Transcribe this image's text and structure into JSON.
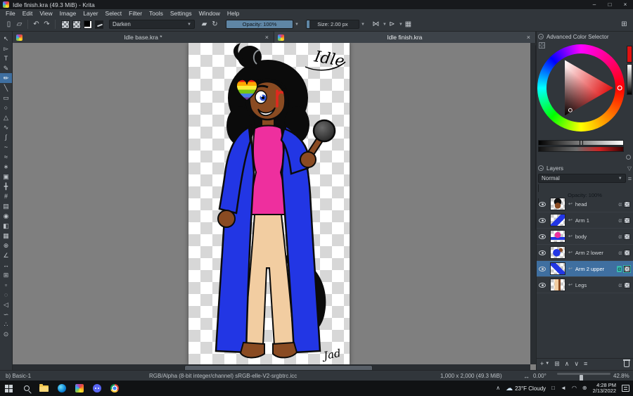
{
  "window": {
    "title": "Idle finish.kra (49.3 MiB) - Krita"
  },
  "menubar": {
    "items": [
      "File",
      "Edit",
      "View",
      "Image",
      "Layer",
      "Select",
      "Filter",
      "Tools",
      "Settings",
      "Window",
      "Help"
    ]
  },
  "toolbar": {
    "blend_mode": "Darken",
    "opacity": "Opacity: 100%",
    "size": "Size: 2.00 px"
  },
  "toolbox": {
    "tools": [
      {
        "name": "select-shapes",
        "glyph": "↖"
      },
      {
        "name": "edit-shapes",
        "glyph": "▻"
      },
      {
        "name": "text",
        "glyph": "T"
      },
      {
        "name": "calligraphy",
        "glyph": "✎"
      },
      {
        "name": "freehand-brush",
        "glyph": "✏",
        "active": true
      },
      {
        "name": "line",
        "glyph": "╲"
      },
      {
        "name": "rectangle",
        "glyph": "▭"
      },
      {
        "name": "ellipse",
        "glyph": "○"
      },
      {
        "name": "polygon",
        "glyph": "△"
      },
      {
        "name": "polyline",
        "glyph": "∿"
      },
      {
        "name": "bezier-curve",
        "glyph": "∫"
      },
      {
        "name": "freehand-path",
        "glyph": "~"
      },
      {
        "name": "dynamic-brush",
        "glyph": "≈"
      },
      {
        "name": "multibrush",
        "glyph": "∗"
      },
      {
        "name": "transform",
        "glyph": "▣"
      },
      {
        "name": "move",
        "glyph": "╋"
      },
      {
        "name": "crop",
        "glyph": "#"
      },
      {
        "name": "gradient",
        "glyph": "▤"
      },
      {
        "name": "color-sampler",
        "glyph": "◉"
      },
      {
        "name": "fill",
        "glyph": "◧"
      },
      {
        "name": "pattern-fill",
        "glyph": "▦"
      },
      {
        "name": "smart-patch",
        "glyph": "⊕"
      },
      {
        "name": "assistants",
        "glyph": "∠"
      },
      {
        "name": "measure",
        "glyph": "↔"
      },
      {
        "name": "reference-images",
        "glyph": "⊞"
      },
      {
        "name": "rect-select",
        "glyph": "▫"
      },
      {
        "name": "ellipse-select",
        "glyph": "◌"
      },
      {
        "name": "polygon-select",
        "glyph": "◁"
      },
      {
        "name": "freehand-select",
        "glyph": "∽"
      },
      {
        "name": "contiguous-select",
        "glyph": "∴"
      },
      {
        "name": "zoom",
        "glyph": "⊙"
      }
    ]
  },
  "tabs": [
    {
      "label": "Idle base.kra *"
    },
    {
      "label": "Idle finish.kra"
    }
  ],
  "canvas": {
    "annotation": "Idle",
    "signature": "Jad"
  },
  "color_selector": {
    "title": "Advanced Color Selector"
  },
  "layers_panel": {
    "title": "Layers",
    "blend_mode": "Normal",
    "opacity": "Opacity: 100%",
    "alpha_label": "α",
    "layers": [
      {
        "name": "head"
      },
      {
        "name": "Arm 1"
      },
      {
        "name": "body"
      },
      {
        "name": "Arm 2 lower"
      },
      {
        "name": "Arm 2 upper",
        "selected": true
      },
      {
        "name": "Legs"
      }
    ]
  },
  "statusbar": {
    "brush_preset": "b) Basic-1",
    "color_profile": "RGB/Alpha (8-bit integer/channel)  sRGB-elle-V2-srgbtrc.icc",
    "doc_size": "1,000 x 2,000 (49.3 MiB)",
    "angle": "0.00°",
    "zoom": "42.8%"
  },
  "taskbar": {
    "weather": "23°F Cloudy",
    "time": "4:28 PM",
    "date": "2/13/2022"
  },
  "colors": {
    "selection_accent": "#3f6fa0",
    "slider_fill": "#6d8fa8",
    "coat_blue": "#2236e4",
    "top_pink": "#ee2f9e",
    "pants_tan": "#f2cda1",
    "skin_brown": "#8a4b22"
  }
}
